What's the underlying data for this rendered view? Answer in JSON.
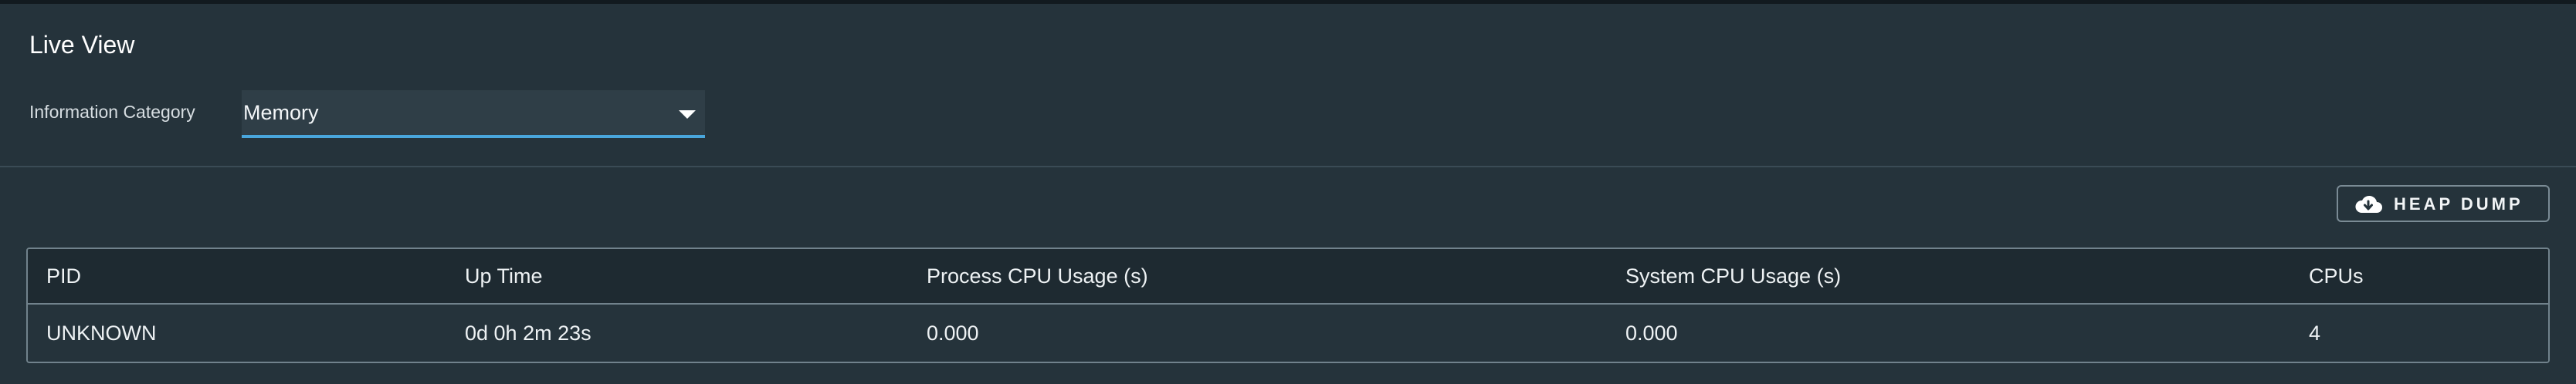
{
  "page": {
    "title": "Live View"
  },
  "filter": {
    "label": "Information Category",
    "selected": "Memory"
  },
  "actions": {
    "heap_dump_label": "HEAP DUMP",
    "heap_dump_icon": "cloud-download-icon"
  },
  "table": {
    "columns": [
      "PID",
      "Up Time",
      "Process CPU Usage (s)",
      "System CPU Usage (s)",
      "CPUs"
    ],
    "rows": [
      [
        "UNKNOWN",
        "0d 0h 2m 23s",
        "0.000",
        "0.000",
        "4"
      ]
    ]
  },
  "colors": {
    "background": "#25333b",
    "header_background": "#1e2a31",
    "select_background": "#2f3e47",
    "accent": "#49a6dc",
    "border": "#71828c"
  }
}
